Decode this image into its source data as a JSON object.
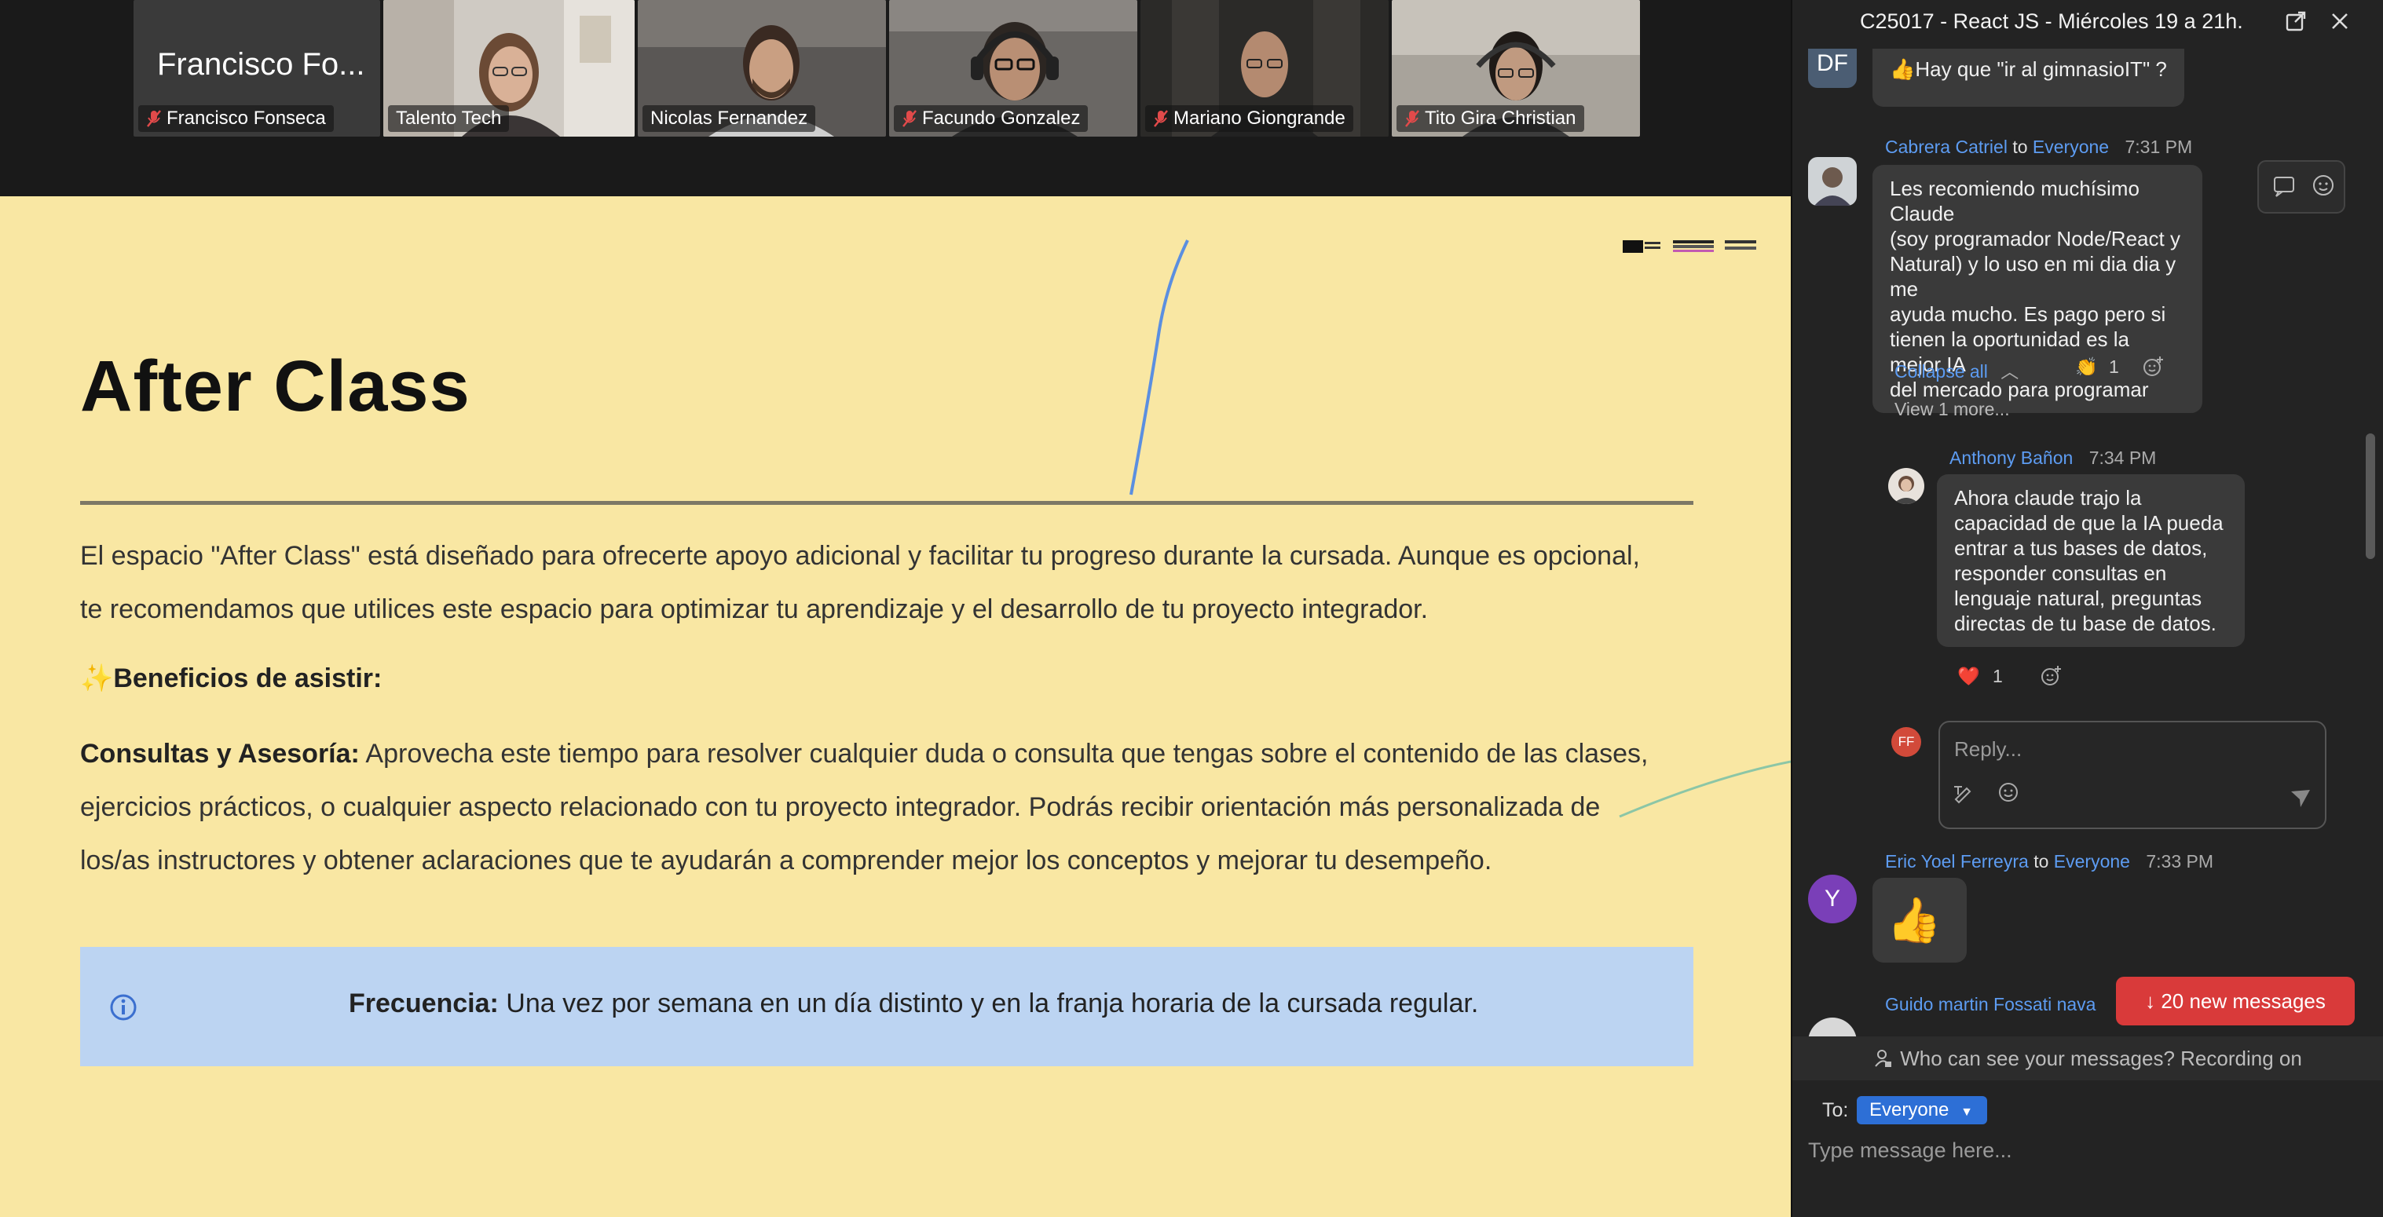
{
  "gallery": {
    "tiles": [
      {
        "name": "Francisco Fonseca",
        "big_name": "Francisco Fo...",
        "muted": true,
        "video": false
      },
      {
        "name": "Talento Tech",
        "muted": false,
        "video": true,
        "active": true
      },
      {
        "name": "Nicolas Fernandez",
        "muted": false,
        "video": true
      },
      {
        "name": "Facundo Gonzalez",
        "muted": true,
        "video": true
      },
      {
        "name": "Mariano Giongrande",
        "muted": true,
        "video": true
      },
      {
        "name": "Tito Gira Christian",
        "muted": true,
        "video": true
      }
    ]
  },
  "slide": {
    "title": "After Class",
    "intro_line1": "El espacio \"After Class\" está diseñado para ofrecerte apoyo adicional y facilitar tu progreso durante la cursada. Aunque es opcional,",
    "intro_line2": "te recomendamos que utilices este espacio para optimizar tu aprendizaje y el desarrollo de tu proyecto integrador.",
    "benefits_emoji": "✨",
    "benefits_heading": "Beneficios de asistir:",
    "consultas_label": "Consultas y Asesoría:",
    "consultas_line1": " Aprovecha este tiempo para resolver cualquier duda o consulta que tengas sobre el contenido de las clases,",
    "consultas_line2": "ejercicios prácticos, o cualquier aspecto relacionado con tu proyecto integrador. Podrás recibir orientación más personalizada de",
    "consultas_line3": "los/as instructores y obtener aclaraciones que te ayudarán a comprender mejor los conceptos y mejorar tu desempeño.",
    "frecuencia_label": "Frecuencia:",
    "frecuencia_text": " Una vez por semana en un día distinto y en la franja horaria de la cursada regular.",
    "info_icon": "info-circle-icon",
    "colors": {
      "background": "#f9e7a3",
      "callout": "#bcd4f2",
      "annotation": "#5b8fe0"
    }
  },
  "chat": {
    "title": "C25017 - React JS - Miércoles 19 a 21h.",
    "messages": [
      {
        "avatar": "DF",
        "text": "👍Hay que \"ir al gimnasioIT\" ?"
      },
      {
        "sender": "Cabrera Catriel",
        "to_word": "to",
        "to": "Everyone",
        "time": "7:31 PM",
        "text_lines": [
          "Les recomiendo muchísimo Claude",
          "(soy programador Node/React y",
          "Natural) y lo uso en mi dia dia y me",
          "ayuda mucho. Es pago pero si",
          "tienen la oportunidad es la mejor IA",
          "del mercado para programar"
        ],
        "collapse_label": "Collapse all",
        "reaction_emoji": "👏",
        "reaction_count": "1",
        "view_more": "View 1 more..."
      },
      {
        "sender": "Anthony Bañon",
        "time": "7:34 PM",
        "text_lines": [
          "Ahora claude trajo la",
          "capacidad de que la IA pueda",
          "entrar a tus bases de datos,",
          "responder consultas en",
          "lenguaje natural, preguntas",
          "directas de tu base de datos."
        ],
        "reaction_emoji": "❤️",
        "reaction_count": "1"
      },
      {
        "reply_avatar": "FF",
        "reply_placeholder": "Reply..."
      },
      {
        "avatar": "Y",
        "sender": "Eric Yoel Ferreyra",
        "to_word": "to",
        "to": "Everyone",
        "time": "7:33 PM",
        "text": "👍"
      },
      {
        "sender": "Guido martin Fossati nava"
      }
    ],
    "new_messages": "↓ 20 new messages",
    "privacy": "Who can see your messages? Recording on",
    "to_label": "To:",
    "to_value": "Everyone",
    "input_placeholder": "Type message here...",
    "colors": {
      "panel": "#232323",
      "link": "#5d9cf2",
      "new_messages": "#d93a3a",
      "to_select": "#2d6fd6"
    }
  }
}
